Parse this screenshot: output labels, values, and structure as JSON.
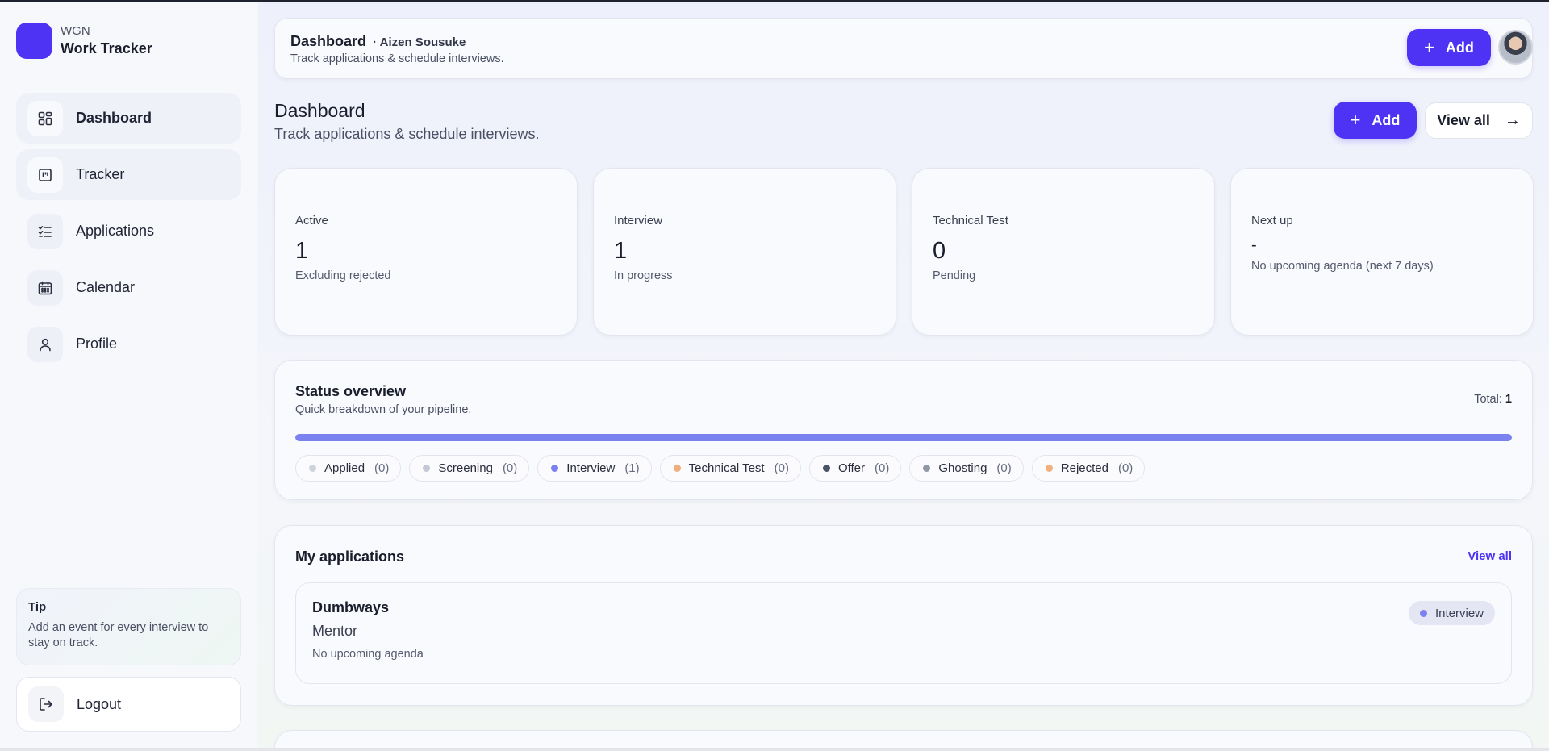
{
  "brand": {
    "sub": "WGN",
    "title": "Work Tracker"
  },
  "nav": [
    {
      "label": "Dashboard",
      "icon": "dashboard-icon"
    },
    {
      "label": "Tracker",
      "icon": "kanban-icon"
    },
    {
      "label": "Applications",
      "icon": "checklist-icon"
    },
    {
      "label": "Calendar",
      "icon": "calendar-icon"
    },
    {
      "label": "Profile",
      "icon": "user-icon"
    }
  ],
  "tip": {
    "title": "Tip",
    "text": "Add an event for every interview to stay on track."
  },
  "logout": {
    "label": "Logout",
    "icon": "logout-icon"
  },
  "header": {
    "title": "Dashboard",
    "user": "· Aizen Sousuke",
    "subtitle": "Track applications & schedule interviews.",
    "add_label": "Add"
  },
  "page": {
    "title": "Dashboard",
    "subtitle": "Track applications & schedule interviews.",
    "add_label": "Add",
    "view_all_label": "View all"
  },
  "stats": [
    {
      "label": "Active",
      "value": "1",
      "note": "Excluding rejected"
    },
    {
      "label": "Interview",
      "value": "1",
      "note": "In progress"
    },
    {
      "label": "Technical Test",
      "value": "0",
      "note": "Pending"
    },
    {
      "label": "Next up",
      "value": "-",
      "note": "No upcoming agenda (next 7 days)"
    }
  ],
  "status": {
    "title": "Status overview",
    "subtitle": "Quick breakdown of your pipeline.",
    "total_label": "Total:",
    "total_value": "1",
    "fill_fraction": 1.0,
    "fill_color": "#7c81f0",
    "chips": [
      {
        "name": "Applied",
        "count": "(0)",
        "color": "#cfd2dd"
      },
      {
        "name": "Screening",
        "count": "(0)",
        "color": "#c4c7d4"
      },
      {
        "name": "Interview",
        "count": "(1)",
        "color": "#7c81f0"
      },
      {
        "name": "Technical Test",
        "count": "(0)",
        "color": "#efae7c"
      },
      {
        "name": "Offer",
        "count": "(0)",
        "color": "#4b5366"
      },
      {
        "name": "Ghosting",
        "count": "(0)",
        "color": "#9297a6"
      },
      {
        "name": "Rejected",
        "count": "(0)",
        "color": "#f1b07c"
      }
    ]
  },
  "applications": {
    "title": "My applications",
    "view_all_label": "View all",
    "items": [
      {
        "company": "Dumbways",
        "role": "Mentor",
        "agenda": "No upcoming agenda",
        "status": "Interview"
      }
    ]
  },
  "colors": {
    "accent": "#4f33f5"
  }
}
